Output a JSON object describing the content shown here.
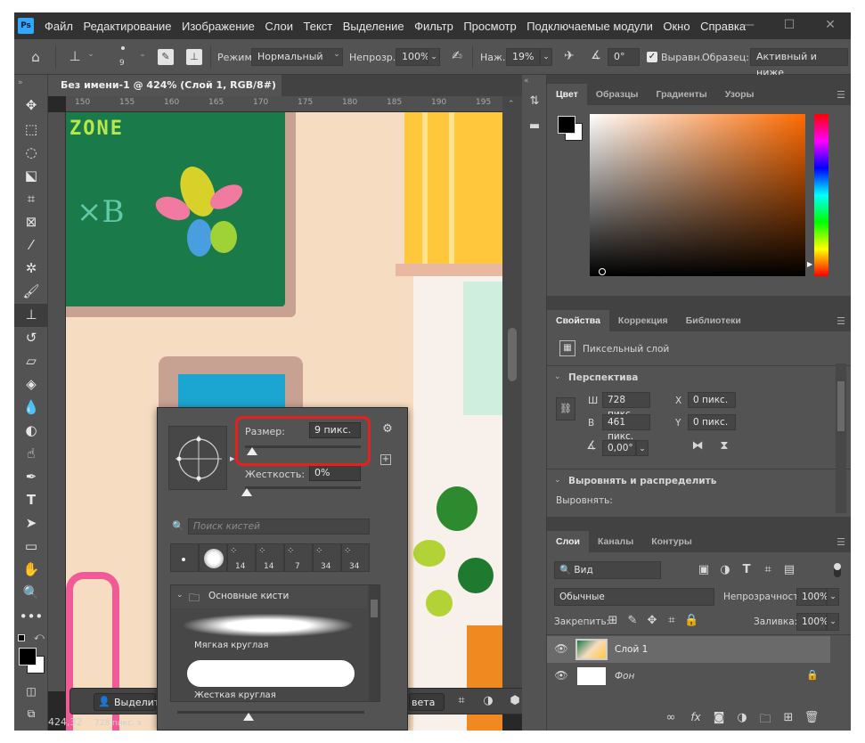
{
  "app": {
    "logo": "Ps"
  },
  "menu": [
    "Файл",
    "Редактирование",
    "Изображение",
    "Слои",
    "Текст",
    "Выделение",
    "Фильтр",
    "Просмотр",
    "Подключаемые модули",
    "Окно",
    "Справка"
  ],
  "window_controls": {
    "minimize": "—",
    "maximize": "☐",
    "close": "✕"
  },
  "options": {
    "brush_size": "9",
    "mode_label": "Режим:",
    "mode_value": "Нормальный",
    "opacity_label": "Непрозр.:",
    "opacity_value": "100%",
    "flow_label": "Наж.:",
    "flow_value": "19%",
    "angle_value": "0°",
    "aligned_label": "Выравн.",
    "sample_label": "Образец:",
    "sample_value": "Активный и ниже"
  },
  "document": {
    "tab_title": "Без имени-1 @ 424% (Слой 1, RGB/8#) *",
    "tab_close": "×",
    "zoom": "424,32",
    "status": "728 пикс. x",
    "ruler_ticks": [
      "150",
      "155",
      "160",
      "165",
      "170",
      "175",
      "180",
      "185",
      "190",
      "195"
    ],
    "art_text": "ZONE"
  },
  "brush_popup": {
    "size_label": "Размер:",
    "size_value": "9 пикс.",
    "hardness_label": "Жесткость:",
    "hardness_value": "0%",
    "hardness_fraction": 0.0,
    "search_placeholder": "Поиск кистей",
    "preset_sizes": [
      "",
      "",
      "14",
      "14",
      "7",
      "34",
      "34"
    ],
    "folder_label": "Основные кисти",
    "brush_soft": "Мягкая круглая",
    "brush_hard": "Жесткая круглая"
  },
  "float_bar": {
    "select_label": "Выделит",
    "color_label": "вета",
    "more": "•••"
  },
  "color_panel": {
    "tabs": [
      "Цвет",
      "Образцы",
      "Градиенты",
      "Узоры"
    ],
    "fg": "#000000",
    "bg": "#ffffff",
    "hue": "#ff6a00"
  },
  "properties_panel": {
    "tabs": [
      "Свойства",
      "Коррекция",
      "Библиотеки"
    ],
    "layer_type": "Пиксельный слой",
    "perspective_title": "Перспектива",
    "w_label": "Ш",
    "w_value": "728 пикс.",
    "h_label": "В",
    "h_value": "461 пикс.",
    "x_label": "X",
    "x_value": "0 пикс.",
    "y_label": "Y",
    "y_value": "0 пикс.",
    "angle_value": "0,00°",
    "align_title": "Выровнять и распределить",
    "align_label": "Выровнять:"
  },
  "layers_panel": {
    "tabs": [
      "Слои",
      "Каналы",
      "Контуры"
    ],
    "filter_label": "Вид",
    "blend_mode": "Обычные",
    "opacity_label": "Непрозрачность:",
    "opacity_value": "100%",
    "lock_label": "Закрепить:",
    "fill_label": "Заливка:",
    "fill_value": "100%",
    "layers": [
      {
        "name": "Слой 1",
        "selected": true
      },
      {
        "name": "Фон",
        "selected": false
      }
    ],
    "footer_fx": "fx"
  }
}
